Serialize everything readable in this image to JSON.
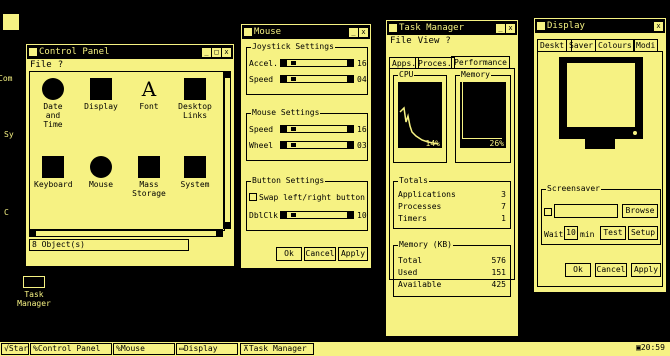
{
  "desktop": {
    "icons": [
      {
        "label": "Com"
      },
      {
        "label": "Sy"
      },
      {
        "label": "C"
      },
      {
        "label": "Task Manager"
      }
    ]
  },
  "control_panel": {
    "title": "Control Panel",
    "menu": [
      "File",
      "?"
    ],
    "icons": [
      {
        "label": "Date and Time",
        "icon": "clock-icon"
      },
      {
        "label": "Display",
        "icon": "display-icon"
      },
      {
        "label": "Font",
        "icon": "font-icon"
      },
      {
        "label": "Desktop Links",
        "icon": "desktop-links-icon"
      },
      {
        "label": "Keyboard",
        "icon": "keyboard-icon"
      },
      {
        "label": "Mouse",
        "icon": "mouse-icon"
      },
      {
        "label": "Mass Storage",
        "icon": "mass-storage-icon"
      },
      {
        "label": "System",
        "icon": "system-icon"
      }
    ],
    "status": "8 Object(s)"
  },
  "mouse": {
    "title": "Mouse",
    "joystick": {
      "label": "Joystick Settings",
      "accel_label": "Accel.",
      "accel_value": "16",
      "speed_label": "Speed",
      "speed_value": "04"
    },
    "mouse_settings": {
      "label": "Mouse Settings",
      "speed_label": "Speed",
      "speed_value": "16",
      "wheel_label": "Wheel",
      "wheel_value": "03"
    },
    "button": {
      "label": "Button Settings",
      "swap_label": "Swap left/right button",
      "dblclk_label": "DblClk",
      "dblclk_value": "10"
    },
    "ok": "Ok",
    "cancel": "Cancel",
    "apply": "Apply"
  },
  "task_manager": {
    "title": "Task Manager",
    "menu": [
      "File",
      "View",
      "?"
    ],
    "tabs": [
      "Apps.",
      "Proces.",
      "Performance"
    ],
    "cpu_label": "CPU",
    "cpu_value": "14%",
    "memory_label": "Memory",
    "memory_value": "26%",
    "totals_label": "Totals",
    "totals": [
      {
        "k": "Applications",
        "v": "3"
      },
      {
        "k": "Processes",
        "v": "7"
      },
      {
        "k": "Timers",
        "v": "1"
      }
    ],
    "memkb_label": "Memory (KB)",
    "memkb": [
      {
        "k": "Total",
        "v": "576"
      },
      {
        "k": "Used",
        "v": "151"
      },
      {
        "k": "Available",
        "v": "425"
      }
    ]
  },
  "display": {
    "title": "Display",
    "tabs": [
      "Deskt.",
      "Saver",
      "Colours",
      "Modi"
    ],
    "screensaver_label": "Screensaver",
    "browse": "Browse",
    "wait_label": "Wait",
    "wait_value": "10",
    "min_label": "min",
    "test": "Test",
    "setup": "Setup",
    "ok": "Ok",
    "cancel": "Cancel",
    "apply": "Apply"
  },
  "taskbar": {
    "start": "Start",
    "items": [
      "Control Panel",
      "Mouse",
      "Display",
      "Task Manager"
    ],
    "clock": "20:59"
  }
}
